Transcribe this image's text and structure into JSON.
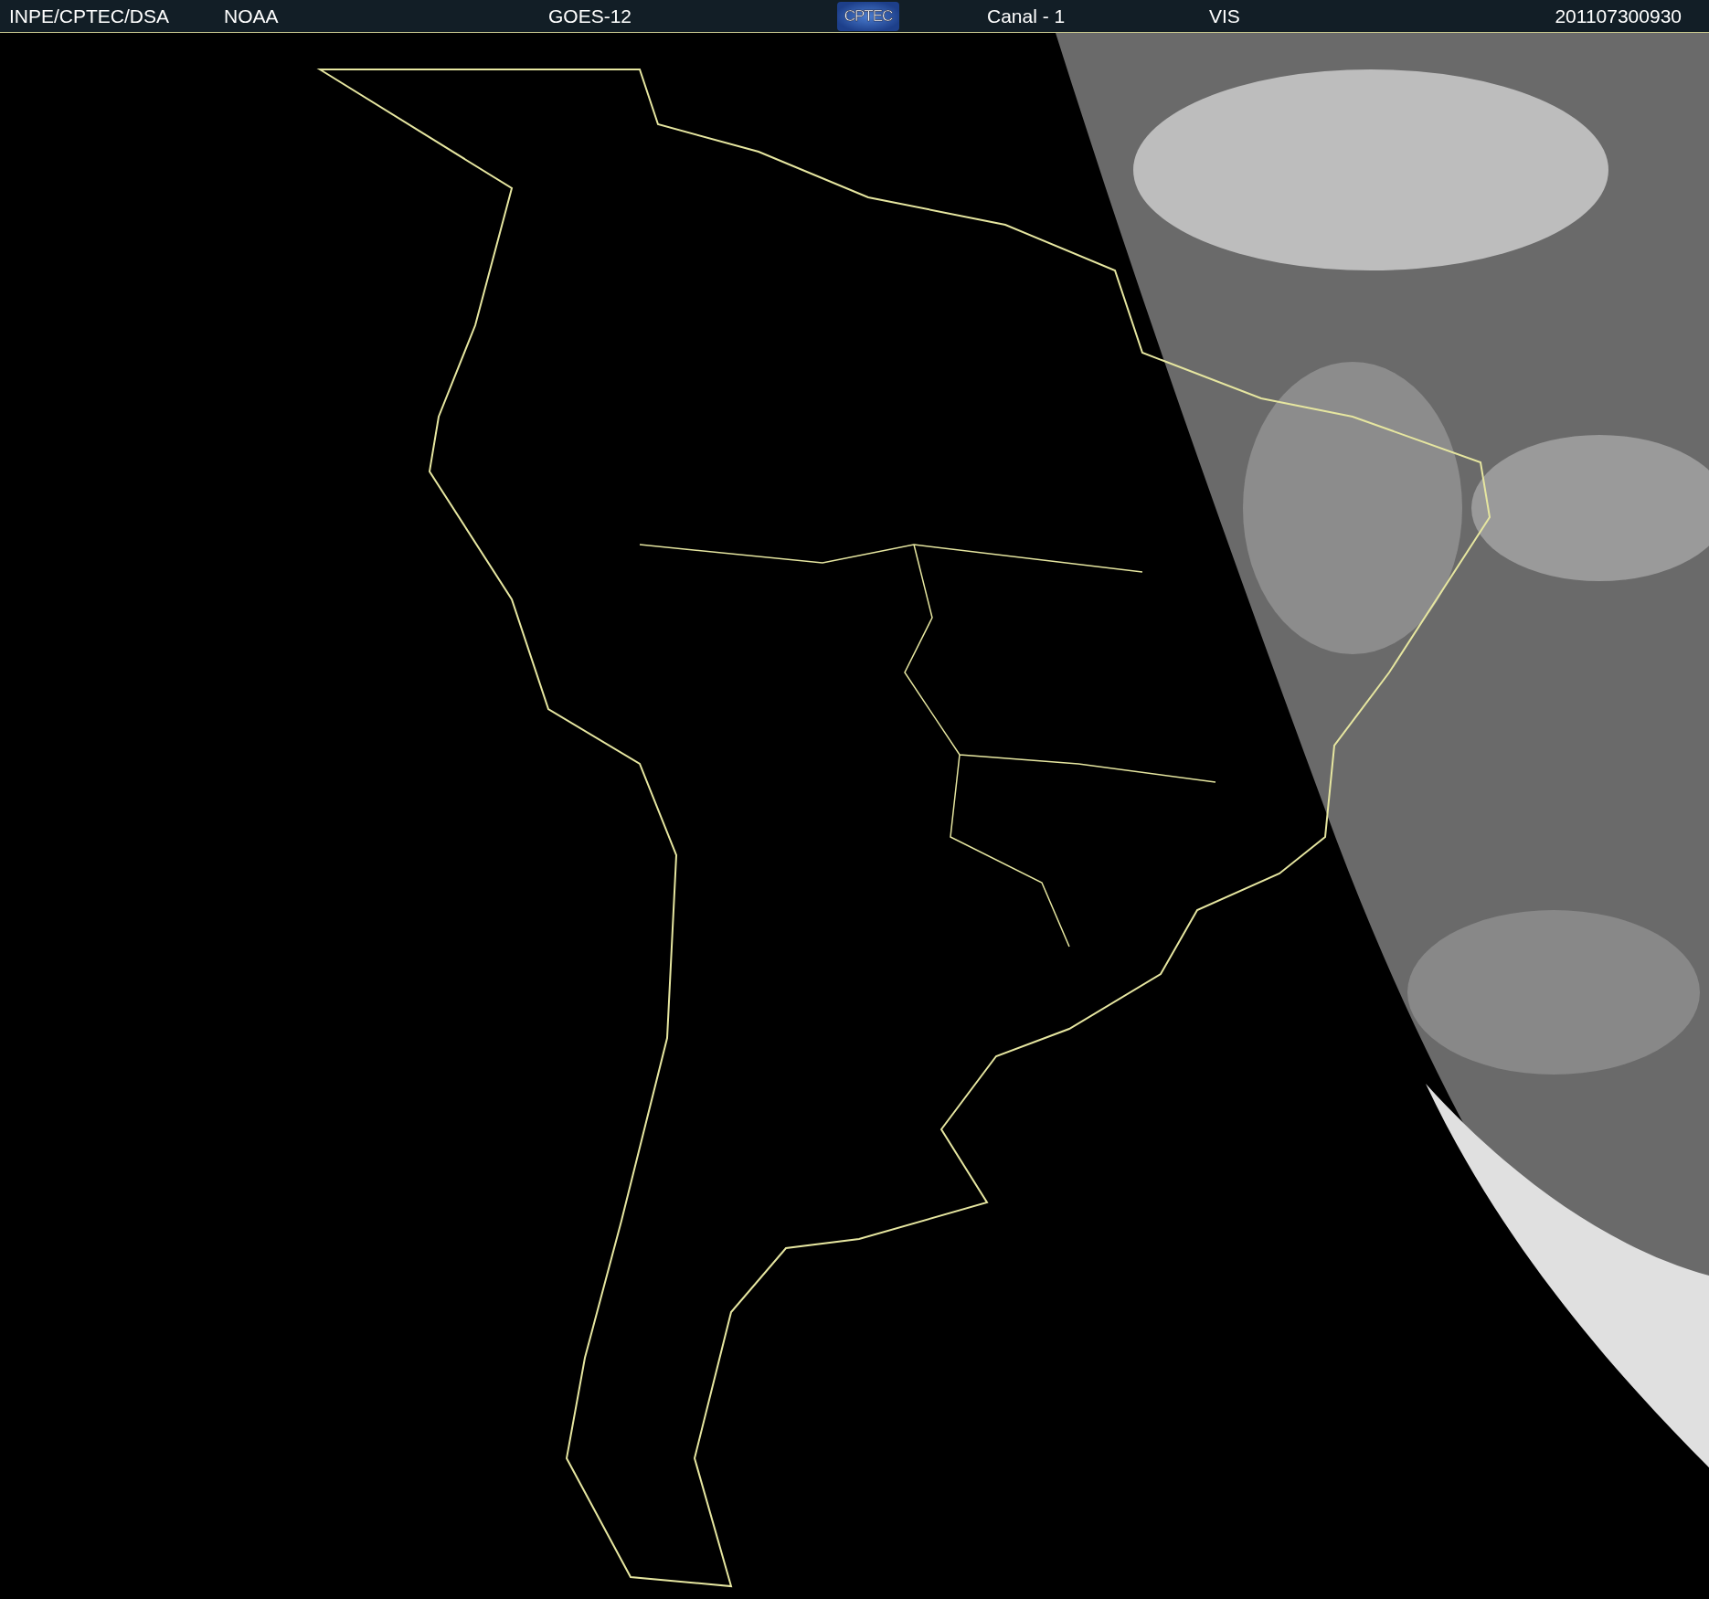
{
  "header": {
    "items": [
      "INPE/CPTEC/DSA",
      "NOAA",
      "GOES-12"
    ],
    "logo": "CPTEC",
    "channel": "Canal - 1",
    "band": "VIS",
    "timestamp": "201107300930"
  }
}
